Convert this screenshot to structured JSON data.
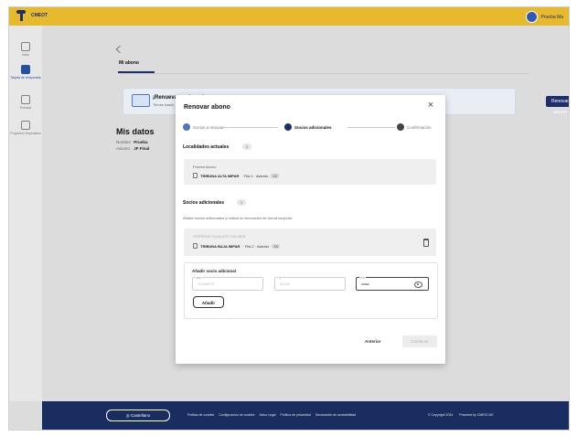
{
  "app": {
    "brand": "CMEOT",
    "user": "Prueba Ma"
  },
  "colors": {
    "brand_yellow": "#e7b92c",
    "navy": "#1d2f6b",
    "blue": "#264ea3"
  },
  "sidebar": {
    "items": [
      {
        "label": "Inicio",
        "icon": "home-icon",
        "active": false
      },
      {
        "label": "Tarjeta de temporada",
        "icon": "card-icon",
        "active": true
      },
      {
        "label": "Entrada",
        "icon": "ticket-icon",
        "active": false
      },
      {
        "label": "Proyectos Especiales",
        "icon": "star-icon",
        "active": false
      }
    ]
  },
  "page": {
    "tab": "Mi abono",
    "banner": {
      "title": "¡Renueva tu abono!",
      "subtitle": "Tienes hasta",
      "button": "Renovar abono"
    },
    "mydata": {
      "title": "Mis datos",
      "rows": [
        {
          "label": "Nombre",
          "value": "Prueba"
        },
        {
          "label": "Asiento",
          "value": "JF Final"
        }
      ]
    }
  },
  "modal": {
    "title": "Renovar abono",
    "close": "×",
    "steps": [
      {
        "number": "1",
        "label": "Socios a renovar",
        "state": "done"
      },
      {
        "number": "2",
        "label": "Socios adicionales",
        "state": "current"
      },
      {
        "number": "3",
        "label": "Confirmación",
        "state": "pending"
      }
    ],
    "current_section": {
      "title": "Localidades actuales",
      "count": "1",
      "name": "Prueba Abono",
      "code": "TRIBUNA ALTA IMPAR",
      "seat": "· Fila 1 · Asiento",
      "seat_number": "22"
    },
    "additional_section": {
      "title": "Socios adicionales",
      "count": "1",
      "hint": "Añade socios adicionales y realiza la renovación de forma conjunta",
      "name": "SOPREND GUALATE GALIARE",
      "code": "TRIBUNA BAJA IMPAR",
      "seat": "· Fila 2 · Asiento",
      "seat_number": "18"
    },
    "add_form": {
      "title": "Añadir socio adicional",
      "fields": [
        {
          "label": "DNI",
          "value": "12345678",
          "active": false
        },
        {
          "label": "Nº",
          "value": "00130",
          "active": false
        },
        {
          "label": "PIN",
          "value": "cosa",
          "active": true
        }
      ],
      "button": "Añadir"
    },
    "footer": {
      "back": "Anterior",
      "continue": "Continuar"
    }
  },
  "footer": {
    "language": "Castellano",
    "links": [
      "Política de cookies",
      "Configuración de cookies",
      "Aviso Legal",
      "Política de privacidad",
      "Declaración de accesibilidad"
    ],
    "copyright": "© Copyright 2024",
    "powered": "Powered by CMEOCUE"
  }
}
